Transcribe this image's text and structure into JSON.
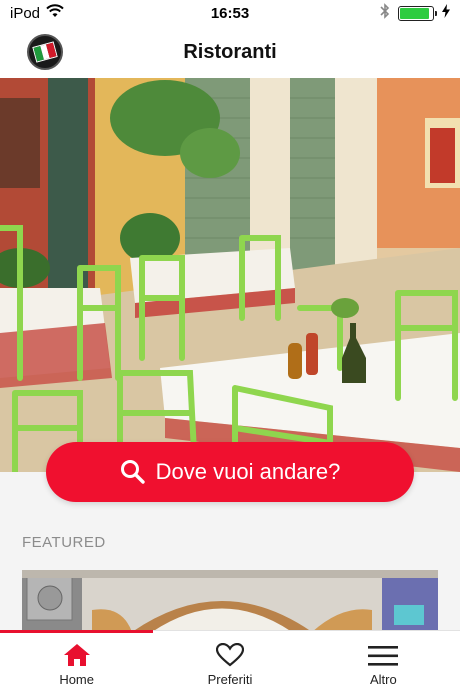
{
  "status_bar": {
    "carrier": "iPod",
    "time": "16:53",
    "battery_level": 0.9
  },
  "header": {
    "title": "Ristoranti"
  },
  "search": {
    "label": "Dove vuoi andare?"
  },
  "featured": {
    "section_label": "FEATURED"
  },
  "tab_bar": {
    "tabs": [
      {
        "label": "Home",
        "icon": "home-icon",
        "active": true
      },
      {
        "label": "Preferiti",
        "icon": "heart-icon",
        "active": false
      },
      {
        "label": "Altro",
        "icon": "menu-icon",
        "active": false
      }
    ]
  },
  "colors": {
    "accent": "#f0102f",
    "active_tab": "#e8102f",
    "featured_label": "#8c8c8c"
  }
}
